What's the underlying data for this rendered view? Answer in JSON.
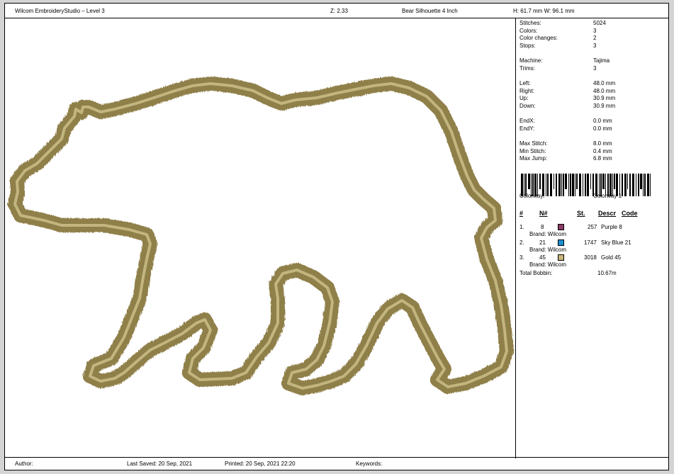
{
  "header": {
    "app_title": "Wilcom EmbroideryStudio – Level 3",
    "zoom": "Z: 2.33",
    "design_name": "Bear Silhouette 4 Inch",
    "size": "H: 61.7 mm   W: 96.1 mm"
  },
  "stats": [
    {
      "label": "Stitches:",
      "value": "5024"
    },
    {
      "label": "Colors:",
      "value": "3"
    },
    {
      "label": "Color changes:",
      "value": "2"
    },
    {
      "label": "Stops:",
      "value": "3"
    },
    {
      "label": "Machine:",
      "value": "Tajima"
    },
    {
      "label": "Trims:",
      "value": "3"
    },
    {
      "label": "Left:",
      "value": "48.0 mm"
    },
    {
      "label": "Right:",
      "value": "48.0 mm"
    },
    {
      "label": "Up:",
      "value": "30.9 mm"
    },
    {
      "label": "Down:",
      "value": "30.9 mm"
    },
    {
      "label": "EndX:",
      "value": "0.0 mm"
    },
    {
      "label": "EndY:",
      "value": "0.0 mm"
    },
    {
      "label": "Max Stitch:",
      "value": "8.0 mm"
    },
    {
      "label": "Min Stitch:",
      "value": "0.4 mm"
    },
    {
      "label": "Max Jump:",
      "value": "6.8 mm"
    }
  ],
  "colorway": {
    "label": "Colorway:",
    "value": "Colorway 1"
  },
  "color_table": {
    "headers": {
      "num": "#",
      "n": "N#",
      "st": "St.",
      "descr": "Descr",
      "code": "Code"
    },
    "rows": [
      {
        "num": "1.",
        "n": "8",
        "color": "#8b3a62",
        "st": "257",
        "descr": "Purple 8",
        "brand": "Brand: Wilcom"
      },
      {
        "num": "2.",
        "n": "21",
        "color": "#1e8fd0",
        "st": "1747",
        "descr": "Sky Blue 21",
        "brand": "Brand: Wilcom"
      },
      {
        "num": "3.",
        "n": "45",
        "color": "#c9b47a",
        "st": "3018",
        "descr": "Gold 45",
        "brand": "Brand: Wilcom"
      }
    ],
    "total_label": "Total Bobbin:",
    "total_value": "10.67m"
  },
  "footer": {
    "author": "Author:",
    "last_saved": "Last Saved: 20 Sep, 2021",
    "printed": "Printed: 20 Sep, 2021 22:20",
    "keywords": "Keywords:"
  },
  "thread_color": "#c8b97e"
}
